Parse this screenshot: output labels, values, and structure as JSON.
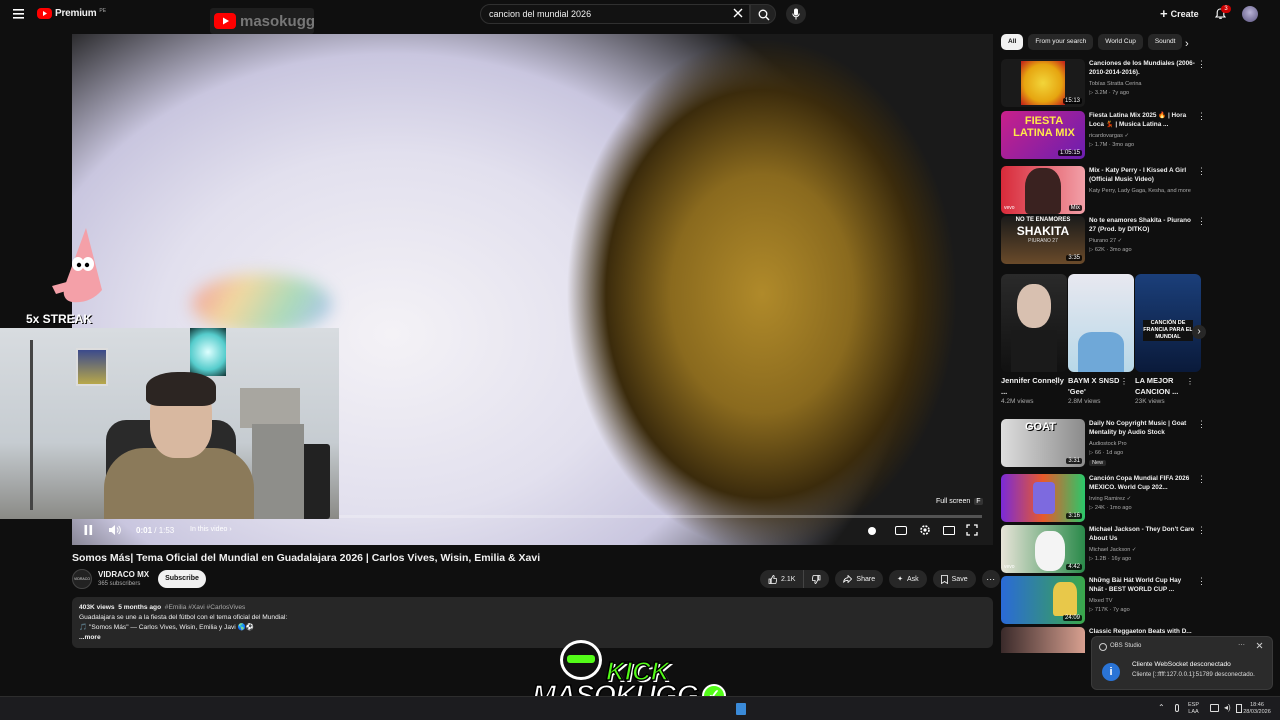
{
  "header": {
    "brand": "Premium",
    "brand_region": "PE",
    "search_value": "cancion del mundial 2026",
    "create_label": "Create",
    "notification_count": "3",
    "watermark": "masokugg"
  },
  "player": {
    "time_current": "0:01",
    "time_total": "1:53",
    "time_sep": " / ",
    "in_this_video": "In this video",
    "fullscreen_tip": "Full screen",
    "fullscreen_key": "F",
    "progress": 0.01
  },
  "overlay": {
    "streak": "5x STREAK",
    "kick_line1": "KICK",
    "kick_line2": "MASOKUGG"
  },
  "video": {
    "title": "Somos Más| Tema Oficial del Mundial en Guadalajara 2026 | Carlos Vives, Wisin, Emilia & Xavi",
    "channel": "VIDRACO MX",
    "channel_avatar": "VIDRACO",
    "subscribers": "365 subscribers",
    "subscribe_label": "Subscribe",
    "likes": "2.1K",
    "share_label": "Share",
    "ask_label": "Ask",
    "save_label": "Save"
  },
  "description": {
    "views": "403K views",
    "age": "5 months ago",
    "tags": "#Emilia #Xavi #CarlosVives",
    "line1": "Guadalajara se une a la fiesta del fútbol con el tema oficial del Mundial:",
    "line2": "🎵 \"Somos Más\" — Carlos Vives, Wisin, Emilia y Javi 🌎⚽",
    "more": "...more"
  },
  "filters": [
    "All",
    "From your search",
    "World Cup",
    "Soundt"
  ],
  "recommendations": [
    {
      "title": "Canciones de los Mundiales (2006-2010-2014-2016).",
      "channel": "Tobías Stratta Cerina",
      "views": "3.2M",
      "age": "7y ago",
      "duration": "15:13",
      "verified": false,
      "badge": ""
    },
    {
      "title": "Fiesta Latina Mix 2025 🔥 | Hora Loca 💃 | Musica Latina ...",
      "channel": "ricardovargas",
      "views": "1.7M",
      "age": "3mo ago",
      "duration": "1:05:15",
      "verified": true,
      "badge": ""
    },
    {
      "title": "Mix - Katy Perry - I Kissed A Girl (Official Music Video)",
      "channel": "Katy Perry, Lady Gaga, Kesha, and more",
      "views": "",
      "age": "",
      "duration": "Mix",
      "verified": false,
      "badge": ""
    },
    {
      "title": "No te enamores Shakita - Piurano 27 (Prod. by DITKO)",
      "channel": "Piurano 27",
      "views": "62K",
      "age": "3mo ago",
      "duration": "3:35",
      "verified": true,
      "badge": ""
    },
    {
      "title": "Daily No Copyright Music | Goat Mentality by Audio Stock",
      "channel": "Audiostock Pro",
      "views": "66",
      "age": "1d ago",
      "duration": "3:31",
      "verified": false,
      "badge": "New"
    },
    {
      "title": "Canción Copa Mundial FIFA 2026 MEXICO. World Cup 202...",
      "channel": "Irving Ramirez",
      "views": "24K",
      "age": "1mo ago",
      "duration": "3:16",
      "verified": true,
      "badge": ""
    },
    {
      "title": "Michael Jackson - They Don't Care About Us",
      "channel": "Michael Jackson",
      "views": "1.2B",
      "age": "16y ago",
      "duration": "4:42",
      "verified": true,
      "badge": ""
    },
    {
      "title": "Những Bài Hát World Cup Hay Nhất - BEST WORLD CUP ...",
      "channel": "Mixed TV",
      "views": "717K",
      "age": "7y ago",
      "duration": "24:09",
      "verified": false,
      "badge": ""
    },
    {
      "title": "Classic Reggaeton Beats with D...",
      "channel": "",
      "views": "",
      "age": "",
      "duration": "",
      "verified": false,
      "badge": ""
    }
  ],
  "shorts": [
    {
      "title": "Jennifer Connelly ...",
      "views": "4.2M views"
    },
    {
      "title": "BAYM X SNSD 'Gee'",
      "views": "2.8M views"
    },
    {
      "title": "LA MEJOR CANCION ...",
      "views": "23K views"
    }
  ],
  "thumb_text": {
    "fiesta": "FIESTA LATINA MIX",
    "shakita_1": "NO TE ENAMORES",
    "shakita_2": "SHAKITA",
    "shakita_3": "PIURANO 27",
    "goat": "GOAT",
    "vevo": "vevo",
    "francia": "CANCIÓN DE FRANCIA PARA EL MUNDIAL"
  },
  "notification": {
    "app": "OBS Studio",
    "title": "Cliente WebSocket desconectado",
    "body": "Cliente [::ffff:127.0.0.1]:51789 desconectado."
  },
  "taskbar": {
    "lang": "ESP",
    "lang2": "LAA",
    "time": "18:46",
    "date": "28/03/2026"
  },
  "colors": {
    "accent_red": "#ff0000",
    "bg": "#0f0f0f",
    "chip_bg": "#272727"
  }
}
